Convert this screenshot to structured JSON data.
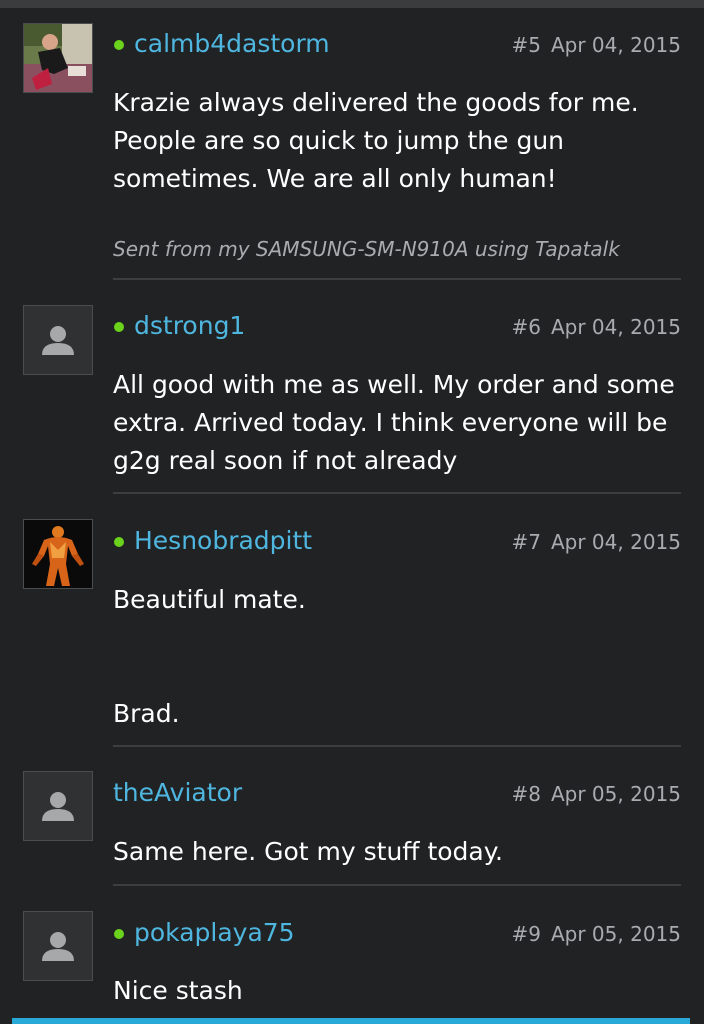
{
  "posts": [
    {
      "username": "calmb4dastorm",
      "online": true,
      "post_number": "#5",
      "date": "Apr 04, 2015",
      "lines": [
        "Krazie always delivered the goods for me.",
        "People are so quick to jump the gun",
        "sometimes. We are all only human!"
      ],
      "signature": "Sent from my SAMSUNG-SM-N910A using Tapatalk",
      "avatar": "photo-avatar"
    },
    {
      "username": "dstrong1",
      "online": true,
      "post_number": "#6",
      "date": "Apr 04, 2015",
      "lines": [
        "All good with me as well. My order and some",
        "extra. Arrived today. I think everyone will be",
        "g2g real soon if not already"
      ],
      "avatar": "default-user-avatar"
    },
    {
      "username": "Hesnobradpitt",
      "online": true,
      "post_number": "#7",
      "date": "Apr 04, 2015",
      "lines": [
        "Beautiful mate.",
        "",
        "",
        "Brad."
      ],
      "avatar": "muscle-figure-avatar"
    },
    {
      "username": "theAviator",
      "online": false,
      "post_number": "#8",
      "date": "Apr 05, 2015",
      "lines": [
        "Same here. Got my stuff today."
      ],
      "avatar": "default-user-avatar"
    },
    {
      "username": "pokaplaya75",
      "online": true,
      "post_number": "#9",
      "date": "Apr 05, 2015",
      "lines": [
        "Nice stash"
      ],
      "avatar": "default-user-avatar"
    }
  ],
  "colors": {
    "background": "#202224",
    "username": "#4fb6df",
    "online_dot": "#6bd31c",
    "meta_text": "#a9acaf",
    "accent_bar": "#29a9d8"
  }
}
